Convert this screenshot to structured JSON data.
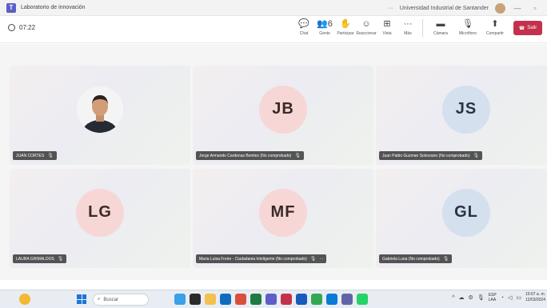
{
  "window": {
    "title": "Laboratorio de innovación",
    "organization": "Universidad Industrial de Santander",
    "dots": "···",
    "minimize": "—",
    "maximize": "▫"
  },
  "meeting": {
    "timer": "07:22",
    "controls": [
      {
        "icon": "💬",
        "label": "Chat",
        "name": "chat"
      },
      {
        "icon": "👥6",
        "label": "Gente",
        "name": "people"
      },
      {
        "icon": "✋",
        "label": "Participar",
        "name": "raise-hand"
      },
      {
        "icon": "☺",
        "label": "Reaccionar",
        "name": "react"
      },
      {
        "icon": "⊞",
        "label": "Vista",
        "name": "view"
      },
      {
        "icon": "···",
        "label": "Más",
        "name": "more"
      }
    ],
    "media": [
      {
        "icon": "▬",
        "label": "Cámara",
        "name": "camera"
      },
      {
        "icon": "🎙",
        "label": "Micrófono",
        "name": "microphone"
      },
      {
        "icon": "⬆",
        "label": "Compartir",
        "name": "share"
      }
    ],
    "leave_label": "Salir"
  },
  "participants": [
    {
      "name": "JUAN CORTES",
      "initials": "",
      "color": "photo"
    },
    {
      "name": "Jorge Armando Cardenas Benitez (No comprobado)",
      "initials": "JB",
      "color": "red"
    },
    {
      "name": "Juan Pablo Guzman Solorzano (No comprobado)",
      "initials": "JS",
      "color": "blue"
    },
    {
      "name": "LAURA GRIMALDOS",
      "initials": "LG",
      "color": "red"
    },
    {
      "name": "Maria Luisa Freire - Ciudadania Inteligente (No comprobado)",
      "initials": "MF",
      "color": "red"
    },
    {
      "name": "Gabriela Luna (No comprobado)",
      "initials": "GL",
      "color": "blue"
    }
  ],
  "taskbar": {
    "search_placeholder": "Buscar",
    "lang_top": "ESP",
    "lang_bottom": "LAA",
    "time": "10:07 a. m.",
    "date": "12/03/2024"
  }
}
